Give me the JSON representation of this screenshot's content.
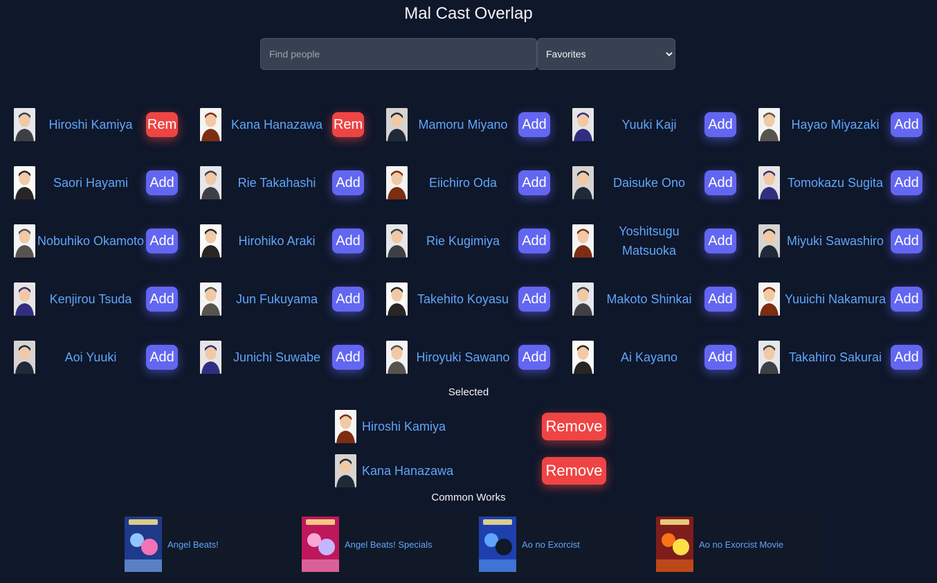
{
  "app": {
    "title": "Mal Cast Overlap"
  },
  "search": {
    "placeholder": "Find people",
    "value": ""
  },
  "filter": {
    "selected": "Favorites",
    "options": [
      "Favorites"
    ]
  },
  "people": [
    {
      "name": "Hiroshi Kamiya",
      "action": "Rem",
      "state": "selected"
    },
    {
      "name": "Kana Hanazawa",
      "action": "Rem",
      "state": "selected"
    },
    {
      "name": "Mamoru Miyano",
      "action": "Add",
      "state": "available"
    },
    {
      "name": "Yuuki Kaji",
      "action": "Add",
      "state": "available"
    },
    {
      "name": "Hayao Miyazaki",
      "action": "Add",
      "state": "available"
    },
    {
      "name": "Saori Hayami",
      "action": "Add",
      "state": "available"
    },
    {
      "name": "Rie Takahashi",
      "action": "Add",
      "state": "available"
    },
    {
      "name": "Eiichiro Oda",
      "action": "Add",
      "state": "available"
    },
    {
      "name": "Daisuke Ono",
      "action": "Add",
      "state": "available"
    },
    {
      "name": "Tomokazu Sugita",
      "action": "Add",
      "state": "available"
    },
    {
      "name": "Nobuhiko Okamoto",
      "action": "Add",
      "state": "available"
    },
    {
      "name": "Hirohiko Araki",
      "action": "Add",
      "state": "available"
    },
    {
      "name": "Rie Kugimiya",
      "action": "Add",
      "state": "available"
    },
    {
      "name": "Yoshitsugu Matsuoka",
      "action": "Add",
      "state": "available"
    },
    {
      "name": "Miyuki Sawashiro",
      "action": "Add",
      "state": "available"
    },
    {
      "name": "Kenjirou Tsuda",
      "action": "Add",
      "state": "available"
    },
    {
      "name": "Jun Fukuyama",
      "action": "Add",
      "state": "available"
    },
    {
      "name": "Takehito Koyasu",
      "action": "Add",
      "state": "available"
    },
    {
      "name": "Makoto Shinkai",
      "action": "Add",
      "state": "available"
    },
    {
      "name": "Yuuichi Nakamura",
      "action": "Add",
      "state": "available"
    },
    {
      "name": "Aoi Yuuki",
      "action": "Add",
      "state": "available"
    },
    {
      "name": "Junichi Suwabe",
      "action": "Add",
      "state": "available"
    },
    {
      "name": "Hiroyuki Sawano",
      "action": "Add",
      "state": "available"
    },
    {
      "name": "Ai Kayano",
      "action": "Add",
      "state": "available"
    },
    {
      "name": "Takahiro Sakurai",
      "action": "Add",
      "state": "available"
    }
  ],
  "selected": {
    "heading": "Selected",
    "items": [
      {
        "name": "Hiroshi Kamiya",
        "button": "Remove"
      },
      {
        "name": "Kana Hanazawa",
        "button": "Remove"
      }
    ]
  },
  "common_works": {
    "heading": "Common Works",
    "items": [
      {
        "title": "Angel Beats!"
      },
      {
        "title": "Angel Beats! Specials"
      },
      {
        "title": "Ao no Exorcist"
      },
      {
        "title": "Ao no Exorcist Movie"
      }
    ]
  },
  "colors": {
    "background": "#0f172a",
    "link": "#60a5fa",
    "add_button": "#6366f1",
    "remove_button": "#ef4444"
  }
}
